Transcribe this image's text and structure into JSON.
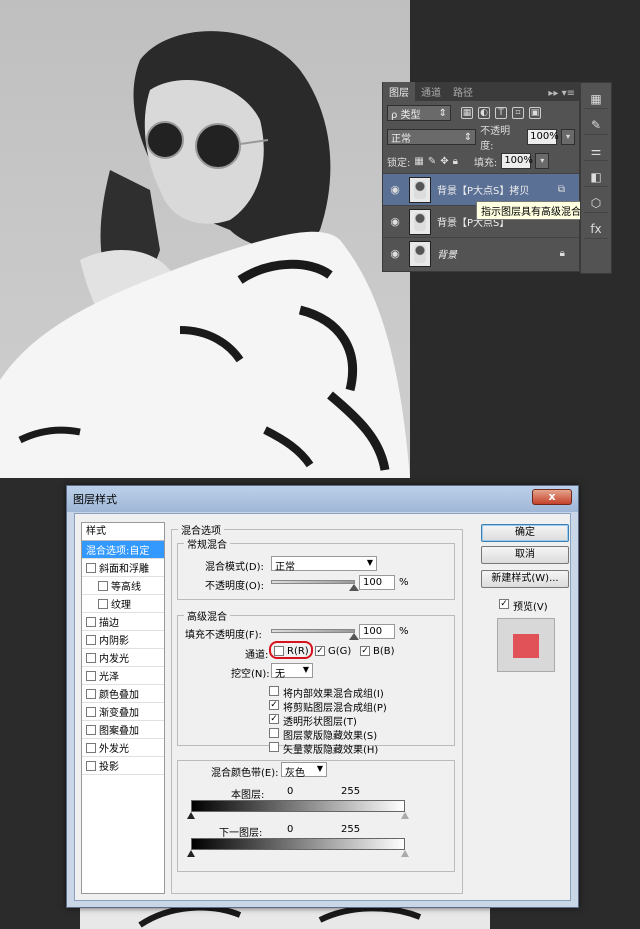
{
  "layers_panel": {
    "tabs": [
      "图层",
      "通道",
      "路径"
    ],
    "tab_menu": "▸▸ ▾≡",
    "filter_kind": "ρ 类型",
    "blend_mode": "正常",
    "opacity_label": "不透明度:",
    "opacity_value": "100%",
    "lock_label": "锁定:",
    "fill_label": "填充:",
    "fill_value": "100%",
    "layers": [
      {
        "name": "背景【P大点S】拷贝"
      },
      {
        "name": "背景【P大点S】"
      },
      {
        "name": "背景"
      }
    ],
    "tooltip": "指示图层具有高级混合选项"
  },
  "dialog": {
    "title": "图层样式",
    "close": "x",
    "styles_header": "样式",
    "styles": [
      {
        "label": "混合选项:自定"
      },
      {
        "label": "斜面和浮雕"
      },
      {
        "label": "等高线"
      },
      {
        "label": "纹理"
      },
      {
        "label": "描边"
      },
      {
        "label": "内阴影"
      },
      {
        "label": "内发光"
      },
      {
        "label": "光泽"
      },
      {
        "label": "颜色叠加"
      },
      {
        "label": "渐变叠加"
      },
      {
        "label": "图案叠加"
      },
      {
        "label": "外发光"
      },
      {
        "label": "投影"
      }
    ],
    "blend_options_title": "混合选项",
    "general_title": "常规混合",
    "blend_mode_label": "混合模式(D):",
    "blend_mode_value": "正常",
    "opacity_label": "不透明度(O):",
    "opacity_value": "100",
    "percent": "%",
    "advanced_title": "高级混合",
    "fill_opacity_label": "填充不透明度(F):",
    "fill_opacity_value": "100",
    "channels_label": "通道:",
    "ch_r": "R(R)",
    "ch_g": "G(G)",
    "ch_b": "B(B)",
    "knockout_label": "挖空(N):",
    "knockout_value": "无",
    "options": [
      {
        "label": "将内部效果混合成组(I)",
        "checked": false
      },
      {
        "label": "将剪贴图层混合成组(P)",
        "checked": true
      },
      {
        "label": "透明形状图层(T)",
        "checked": true
      },
      {
        "label": "图层蒙版隐藏效果(S)",
        "checked": false
      },
      {
        "label": "矢量蒙版隐藏效果(H)",
        "checked": false
      }
    ],
    "blend_if_label": "混合颜色带(E):",
    "blend_if_value": "灰色",
    "this_layer_label": "本图层:",
    "this_layer_min": "0",
    "this_layer_max": "255",
    "underlying_label": "下一图层:",
    "underlying_min": "0",
    "underlying_max": "255",
    "ok": "确定",
    "cancel": "取消",
    "new_style": "新建样式(W)...",
    "preview": "预览(V)",
    "colors": {
      "preview_swatch": "#e05257",
      "selection": "#3399ff",
      "highlight_ring": "#d8121c"
    }
  }
}
